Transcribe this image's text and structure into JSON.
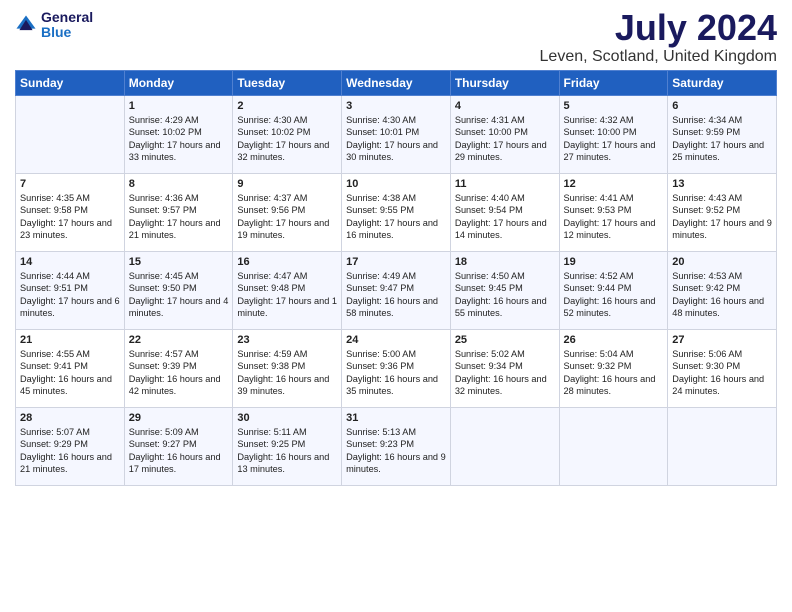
{
  "header": {
    "logo_general": "General",
    "logo_blue": "Blue",
    "month_title": "July 2024",
    "location": "Leven, Scotland, United Kingdom"
  },
  "weekdays": [
    "Sunday",
    "Monday",
    "Tuesday",
    "Wednesday",
    "Thursday",
    "Friday",
    "Saturday"
  ],
  "weeks": [
    [
      {
        "day": "",
        "sunrise": "",
        "sunset": "",
        "daylight": ""
      },
      {
        "day": "1",
        "sunrise": "Sunrise: 4:29 AM",
        "sunset": "Sunset: 10:02 PM",
        "daylight": "Daylight: 17 hours and 33 minutes."
      },
      {
        "day": "2",
        "sunrise": "Sunrise: 4:30 AM",
        "sunset": "Sunset: 10:02 PM",
        "daylight": "Daylight: 17 hours and 32 minutes."
      },
      {
        "day": "3",
        "sunrise": "Sunrise: 4:30 AM",
        "sunset": "Sunset: 10:01 PM",
        "daylight": "Daylight: 17 hours and 30 minutes."
      },
      {
        "day": "4",
        "sunrise": "Sunrise: 4:31 AM",
        "sunset": "Sunset: 10:00 PM",
        "daylight": "Daylight: 17 hours and 29 minutes."
      },
      {
        "day": "5",
        "sunrise": "Sunrise: 4:32 AM",
        "sunset": "Sunset: 10:00 PM",
        "daylight": "Daylight: 17 hours and 27 minutes."
      },
      {
        "day": "6",
        "sunrise": "Sunrise: 4:34 AM",
        "sunset": "Sunset: 9:59 PM",
        "daylight": "Daylight: 17 hours and 25 minutes."
      }
    ],
    [
      {
        "day": "7",
        "sunrise": "Sunrise: 4:35 AM",
        "sunset": "Sunset: 9:58 PM",
        "daylight": "Daylight: 17 hours and 23 minutes."
      },
      {
        "day": "8",
        "sunrise": "Sunrise: 4:36 AM",
        "sunset": "Sunset: 9:57 PM",
        "daylight": "Daylight: 17 hours and 21 minutes."
      },
      {
        "day": "9",
        "sunrise": "Sunrise: 4:37 AM",
        "sunset": "Sunset: 9:56 PM",
        "daylight": "Daylight: 17 hours and 19 minutes."
      },
      {
        "day": "10",
        "sunrise": "Sunrise: 4:38 AM",
        "sunset": "Sunset: 9:55 PM",
        "daylight": "Daylight: 17 hours and 16 minutes."
      },
      {
        "day": "11",
        "sunrise": "Sunrise: 4:40 AM",
        "sunset": "Sunset: 9:54 PM",
        "daylight": "Daylight: 17 hours and 14 minutes."
      },
      {
        "day": "12",
        "sunrise": "Sunrise: 4:41 AM",
        "sunset": "Sunset: 9:53 PM",
        "daylight": "Daylight: 17 hours and 12 minutes."
      },
      {
        "day": "13",
        "sunrise": "Sunrise: 4:43 AM",
        "sunset": "Sunset: 9:52 PM",
        "daylight": "Daylight: 17 hours and 9 minutes."
      }
    ],
    [
      {
        "day": "14",
        "sunrise": "Sunrise: 4:44 AM",
        "sunset": "Sunset: 9:51 PM",
        "daylight": "Daylight: 17 hours and 6 minutes."
      },
      {
        "day": "15",
        "sunrise": "Sunrise: 4:45 AM",
        "sunset": "Sunset: 9:50 PM",
        "daylight": "Daylight: 17 hours and 4 minutes."
      },
      {
        "day": "16",
        "sunrise": "Sunrise: 4:47 AM",
        "sunset": "Sunset: 9:48 PM",
        "daylight": "Daylight: 17 hours and 1 minute."
      },
      {
        "day": "17",
        "sunrise": "Sunrise: 4:49 AM",
        "sunset": "Sunset: 9:47 PM",
        "daylight": "Daylight: 16 hours and 58 minutes."
      },
      {
        "day": "18",
        "sunrise": "Sunrise: 4:50 AM",
        "sunset": "Sunset: 9:45 PM",
        "daylight": "Daylight: 16 hours and 55 minutes."
      },
      {
        "day": "19",
        "sunrise": "Sunrise: 4:52 AM",
        "sunset": "Sunset: 9:44 PM",
        "daylight": "Daylight: 16 hours and 52 minutes."
      },
      {
        "day": "20",
        "sunrise": "Sunrise: 4:53 AM",
        "sunset": "Sunset: 9:42 PM",
        "daylight": "Daylight: 16 hours and 48 minutes."
      }
    ],
    [
      {
        "day": "21",
        "sunrise": "Sunrise: 4:55 AM",
        "sunset": "Sunset: 9:41 PM",
        "daylight": "Daylight: 16 hours and 45 minutes."
      },
      {
        "day": "22",
        "sunrise": "Sunrise: 4:57 AM",
        "sunset": "Sunset: 9:39 PM",
        "daylight": "Daylight: 16 hours and 42 minutes."
      },
      {
        "day": "23",
        "sunrise": "Sunrise: 4:59 AM",
        "sunset": "Sunset: 9:38 PM",
        "daylight": "Daylight: 16 hours and 39 minutes."
      },
      {
        "day": "24",
        "sunrise": "Sunrise: 5:00 AM",
        "sunset": "Sunset: 9:36 PM",
        "daylight": "Daylight: 16 hours and 35 minutes."
      },
      {
        "day": "25",
        "sunrise": "Sunrise: 5:02 AM",
        "sunset": "Sunset: 9:34 PM",
        "daylight": "Daylight: 16 hours and 32 minutes."
      },
      {
        "day": "26",
        "sunrise": "Sunrise: 5:04 AM",
        "sunset": "Sunset: 9:32 PM",
        "daylight": "Daylight: 16 hours and 28 minutes."
      },
      {
        "day": "27",
        "sunrise": "Sunrise: 5:06 AM",
        "sunset": "Sunset: 9:30 PM",
        "daylight": "Daylight: 16 hours and 24 minutes."
      }
    ],
    [
      {
        "day": "28",
        "sunrise": "Sunrise: 5:07 AM",
        "sunset": "Sunset: 9:29 PM",
        "daylight": "Daylight: 16 hours and 21 minutes."
      },
      {
        "day": "29",
        "sunrise": "Sunrise: 5:09 AM",
        "sunset": "Sunset: 9:27 PM",
        "daylight": "Daylight: 16 hours and 17 minutes."
      },
      {
        "day": "30",
        "sunrise": "Sunrise: 5:11 AM",
        "sunset": "Sunset: 9:25 PM",
        "daylight": "Daylight: 16 hours and 13 minutes."
      },
      {
        "day": "31",
        "sunrise": "Sunrise: 5:13 AM",
        "sunset": "Sunset: 9:23 PM",
        "daylight": "Daylight: 16 hours and 9 minutes."
      },
      {
        "day": "",
        "sunrise": "",
        "sunset": "",
        "daylight": ""
      },
      {
        "day": "",
        "sunrise": "",
        "sunset": "",
        "daylight": ""
      },
      {
        "day": "",
        "sunrise": "",
        "sunset": "",
        "daylight": ""
      }
    ]
  ]
}
